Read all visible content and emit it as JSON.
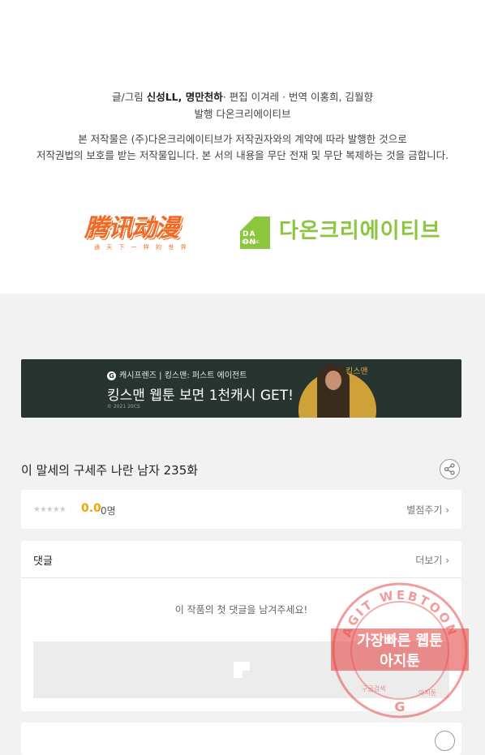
{
  "credits": {
    "line1_prefix": "글/그림 ",
    "line1_authors": "신성LL, 명만천하",
    "line1_suffix": "· 편집 이겨레 · 번역 이홍희, 김월향",
    "line2": "발행 다온크리에이티브",
    "notice1": "본 저작물은 (주)다온크리에이티브가 저작권자와의 계약에 따라 발행한 것으로",
    "notice2": "저작권법의 보호를 받는 저작물입니다. 본 서의 내용을 무단 전재 및 무단 복제하는 것을 금합니다."
  },
  "logos": {
    "tencent_main": "腾讯动漫",
    "tencent_sub": "通 天 下 一 样 的 世 界",
    "daon_mark": "DA ON",
    "daon_mark_sub": "CREATIVE",
    "daon_name": "다온크리에이티브"
  },
  "banner": {
    "brand": "캐시프렌즈 | 킹스맨: 퍼스트 에이전트",
    "brand_icon": "G",
    "headline": "킹스맨 웹툰 보면 1천캐시 GET!",
    "copyright": "© 2021 20CS",
    "movie_logo": "킹스맨"
  },
  "episode": {
    "title": "이 말세의 구세주 나란 남자 235화"
  },
  "rating": {
    "stars": "★★★★★",
    "score": "0.0",
    "count": "0명",
    "rate_label": "별점주기 ›"
  },
  "comments": {
    "label": "댓글",
    "more_label": "더보기 ›",
    "empty_message": "이 작품의 첫 댓글을 남겨주세요!"
  },
  "watermark": {
    "ring_text": "AGIT WEBTOON",
    "line1": "가장빠른 웹툰",
    "line2": "아지툰",
    "bottom_left": "구글검색",
    "bottom_right": "아지툰",
    "google_letter": "G"
  },
  "colors": {
    "tencent_orange": "#f06a24",
    "daon_green": "#8cc63f",
    "score_orange": "#f0a500",
    "banner_bg": "#28342f",
    "watermark_red": "#e84a4a"
  }
}
